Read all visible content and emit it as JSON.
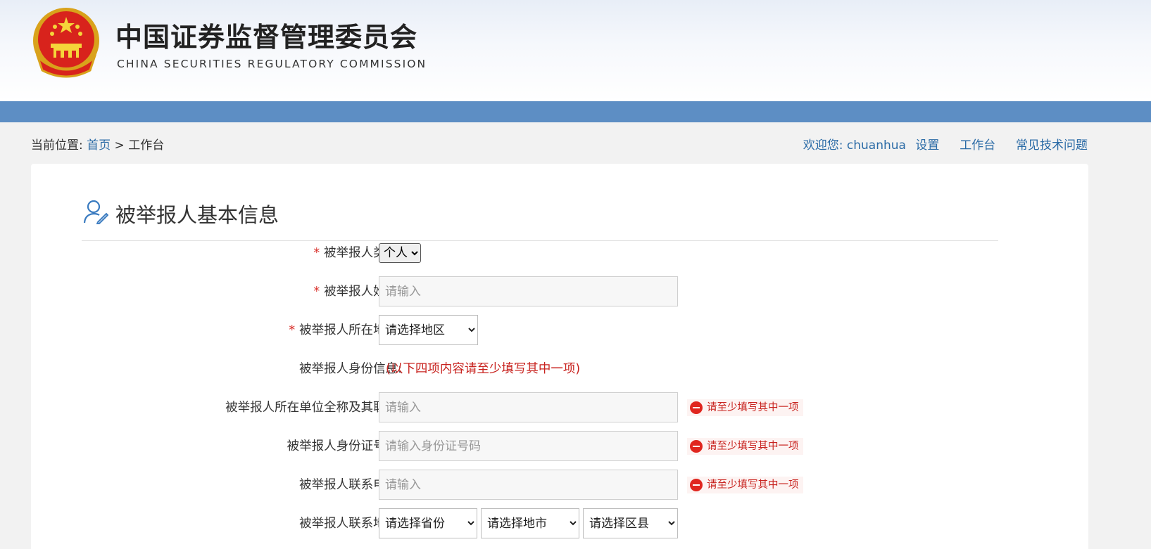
{
  "header": {
    "title_cn": "中国证券监督管理委员会",
    "title_en": "CHINA SECURITIES REGULATORY COMMISSION",
    "emblem_icon": "national-emblem-icon"
  },
  "breadcrumb": {
    "prefix": "当前位置:",
    "home": "首页",
    "separator": ">",
    "current": "工作台"
  },
  "topnav": {
    "welcome": "欢迎您:",
    "username": "chuanhua",
    "settings": "设置",
    "workbench": "工作台",
    "faq": "常见技术问题"
  },
  "section": {
    "title": "被举报人基本信息",
    "icon": "user-edit-icon"
  },
  "form": {
    "category": {
      "label": "被举报人类别:",
      "required": "*",
      "value": "个人"
    },
    "name": {
      "label": "被举报人姓名:",
      "required": "*",
      "placeholder": "请输入"
    },
    "region": {
      "label": "被举报人所在地区:",
      "required": "*",
      "value": "请选择地区"
    },
    "identity": {
      "label": "被举报人身份信息:",
      "hint": "(以下四项内容请至少填写其中一项)"
    },
    "employer": {
      "label": "被举报人所在单位全称及其职务:",
      "placeholder": "请输入",
      "error": "请至少填写其中一项"
    },
    "id_number": {
      "label": "被举报人身份证号码:",
      "placeholder": "请输入身份证号码",
      "error": "请至少填写其中一项"
    },
    "phone": {
      "label": "被举报人联系电话:",
      "placeholder": "请输入",
      "error": "请至少填写其中一项"
    },
    "address": {
      "label": "被举报人联系地址:",
      "province": "请选择省份",
      "city": "请选择地市",
      "county": "请选择区县"
    }
  },
  "colors": {
    "accent_bar": "#5d8ec4",
    "link": "#2b6ba6",
    "error": "#c8231f"
  }
}
